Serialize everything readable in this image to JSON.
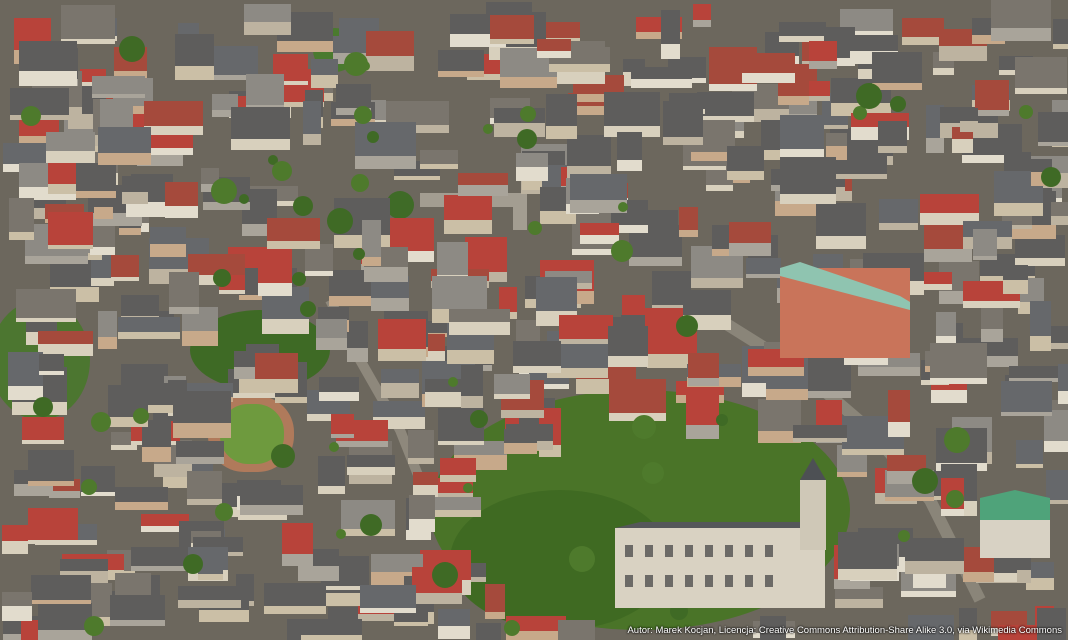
{
  "photo": {
    "caption": "Autor: Marek Kocjan, Licencja: Creative Commons Attribution-Share Alike 3.0, via Wikimedia Commons"
  },
  "palette": {
    "roof_red": "#b8433a",
    "roof_grey": "#5e5d5c",
    "roof_green": "#5c9a78",
    "wall_cream": "#d8d0bd",
    "tree_green": "#4e7a2c",
    "field_green": "#6e9a3e",
    "street": "#8a8579"
  }
}
